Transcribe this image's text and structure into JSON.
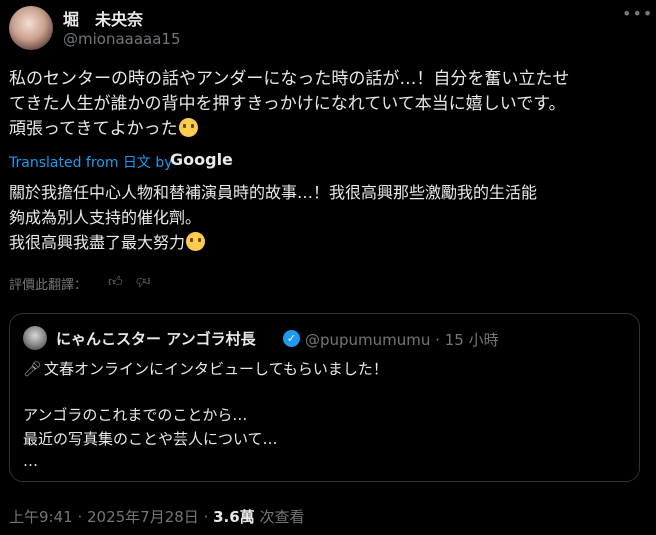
{
  "author": {
    "name": "堀　未央奈",
    "handle": "@mionaaaaa15"
  },
  "post": {
    "line1": "私のセンターの時の話やアンダーになった時の話が…！自分を奮い立たせ",
    "line2": "てきた人生が誰かの背中を押すきっかけになれていて本当に嬉しいです。",
    "line3": "頑張ってきてよかった",
    "emoji": "crying-face"
  },
  "translation": {
    "label": "Translated from 日文 by",
    "provider": "Google",
    "line1": "關於我擔任中心人物和替補演員時的故事…！我很高興那些激勵我的生活能",
    "line2": "夠成為別人支持的催化劑。",
    "line3": "我很高興我盡了最大努力",
    "rate_label": "評價此翻譯："
  },
  "quote": {
    "name": "にゃんこスター アンゴラ村長",
    "handle_time": "@pupumumumu · 15 小時",
    "line1": "文春オンラインにインタビューしてもらいました！",
    "line2": "アンゴラのこれまでのことから…",
    "line3": "最近の写真集のことや芸人について…",
    "line4": "…"
  },
  "footer": {
    "timestamp": "上午9:41 · 2025年7月28日 · ",
    "views": "3.6萬",
    "views_label": " 次查看"
  },
  "colors": {
    "background": "#000000",
    "text": "#e7e9ea",
    "muted": "#71767b",
    "link": "#1d9bf0",
    "border": "#2f3336"
  }
}
